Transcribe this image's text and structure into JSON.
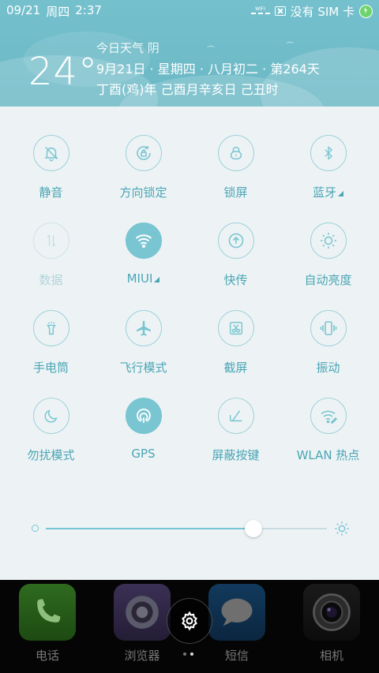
{
  "status_bar": {
    "date": "09/21",
    "weekday": "周四",
    "time": "2:37",
    "wifi_label": "WIFI",
    "sim_text": "没有 SIM 卡",
    "battery_color": "#6bd46b"
  },
  "weather": {
    "temperature": "24°",
    "line1": "今日天气  阴",
    "line2": "9月21日 · 星期四 · 八月初二 · 第264天",
    "line3": "丁酉(鸡)年 己酉月辛亥日 己丑时"
  },
  "toggles": [
    {
      "name": "silent",
      "label": "静音",
      "icon": "bell-off-icon",
      "state": "off"
    },
    {
      "name": "rotation-lock",
      "label": "方向锁定",
      "icon": "rotation-lock-icon",
      "state": "off"
    },
    {
      "name": "lock-screen",
      "label": "锁屏",
      "icon": "lock-icon",
      "state": "off"
    },
    {
      "name": "bluetooth",
      "label": "蓝牙",
      "icon": "bluetooth-icon",
      "state": "off",
      "has_menu": true
    },
    {
      "name": "mobile-data",
      "label": "数据",
      "icon": "data-arrows-icon",
      "state": "disabled"
    },
    {
      "name": "wifi",
      "label": "MIUI",
      "icon": "wifi-icon",
      "state": "on",
      "has_menu": true
    },
    {
      "name": "quick-send",
      "label": "快传",
      "icon": "upload-icon",
      "state": "off"
    },
    {
      "name": "auto-brightness",
      "label": "自动亮度",
      "icon": "sun-icon",
      "state": "off"
    },
    {
      "name": "flashlight",
      "label": "手电筒",
      "icon": "flashlight-icon",
      "state": "off"
    },
    {
      "name": "airplane-mode",
      "label": "飞行模式",
      "icon": "airplane-icon",
      "state": "off"
    },
    {
      "name": "screenshot",
      "label": "截屏",
      "icon": "scissors-icon",
      "state": "off"
    },
    {
      "name": "vibrate",
      "label": "振动",
      "icon": "vibrate-icon",
      "state": "off"
    },
    {
      "name": "do-not-disturb",
      "label": "勿扰模式",
      "icon": "moon-icon",
      "state": "off"
    },
    {
      "name": "gps",
      "label": "GPS",
      "icon": "gps-icon",
      "state": "on"
    },
    {
      "name": "block-keys",
      "label": "屏蔽按键",
      "icon": "block-keys-icon",
      "state": "off"
    },
    {
      "name": "wlan-hotspot",
      "label": "WLAN 热点",
      "icon": "hotspot-icon",
      "state": "off"
    }
  ],
  "brightness": {
    "level_percent": 74
  },
  "colors": {
    "accent": "#79c5d1",
    "label": "#4aa5b5",
    "header": "#6bb8c5",
    "panel": "#edf3f5"
  },
  "dock": {
    "apps": [
      {
        "name": "phone",
        "label": "电话",
        "icon": "phone-icon"
      },
      {
        "name": "browser",
        "label": "浏览器",
        "icon": "browser-icon"
      },
      {
        "name": "messages",
        "label": "短信",
        "icon": "message-icon"
      },
      {
        "name": "camera",
        "label": "相机",
        "icon": "camera-icon"
      }
    ],
    "pages": 2,
    "current_page": 2
  }
}
